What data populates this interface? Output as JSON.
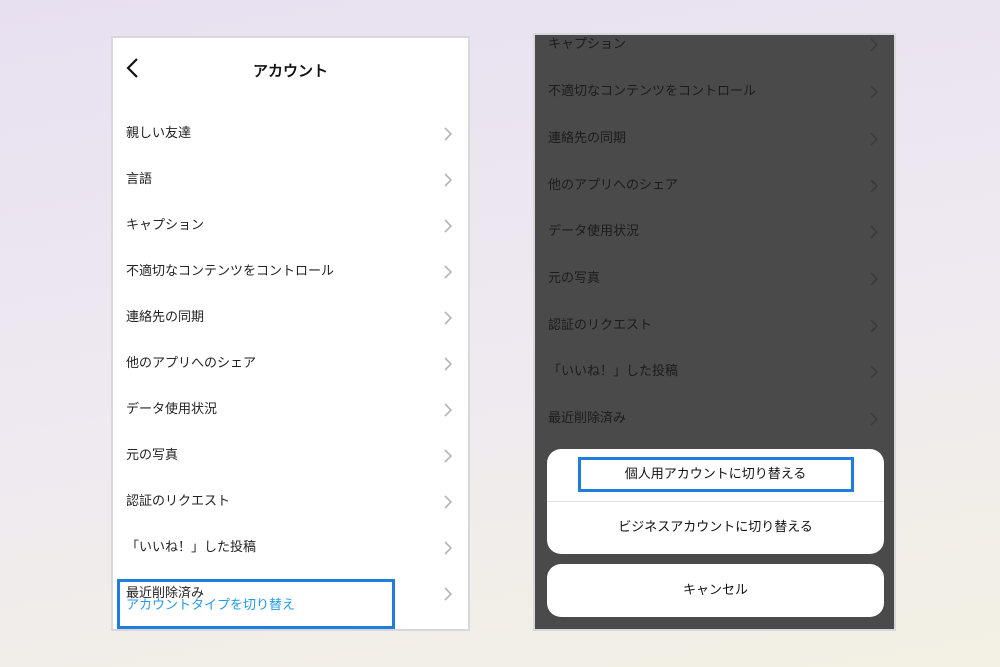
{
  "left_screen": {
    "title": "アカウント",
    "icons": {
      "back": "chevron-left-icon",
      "row": "chevron-right-icon"
    },
    "items": [
      {
        "label": "親しい友達"
      },
      {
        "label": "言語"
      },
      {
        "label": "キャプション"
      },
      {
        "label": "不適切なコンテンツをコントロール"
      },
      {
        "label": "連絡先の同期"
      },
      {
        "label": "他のアプリへのシェア"
      },
      {
        "label": "データ使用状況"
      },
      {
        "label": "元の写真"
      },
      {
        "label": "認証のリクエスト"
      },
      {
        "label": "「いいね！」した投稿"
      },
      {
        "label": "最近削除済み"
      },
      {
        "label": "アカウントタイプを切り替え"
      }
    ],
    "accent_color": "#1d9bf0"
  },
  "right_screen": {
    "items": [
      {
        "label": "キャプション"
      },
      {
        "label": "不適切なコンテンツをコントロール"
      },
      {
        "label": "連絡先の同期"
      },
      {
        "label": "他のアプリへのシェア"
      },
      {
        "label": "データ使用状況"
      },
      {
        "label": "元の写真"
      },
      {
        "label": "認証のリクエスト"
      },
      {
        "label": "「いいね！」した投稿"
      },
      {
        "label": "最近削除済み"
      }
    ],
    "sheet": {
      "option_personal": "個人用アカウントに切り替える",
      "option_business": "ビジネスアカウントに切り替える",
      "cancel": "キャンセル"
    }
  },
  "highlight_color": "#1f7de0"
}
